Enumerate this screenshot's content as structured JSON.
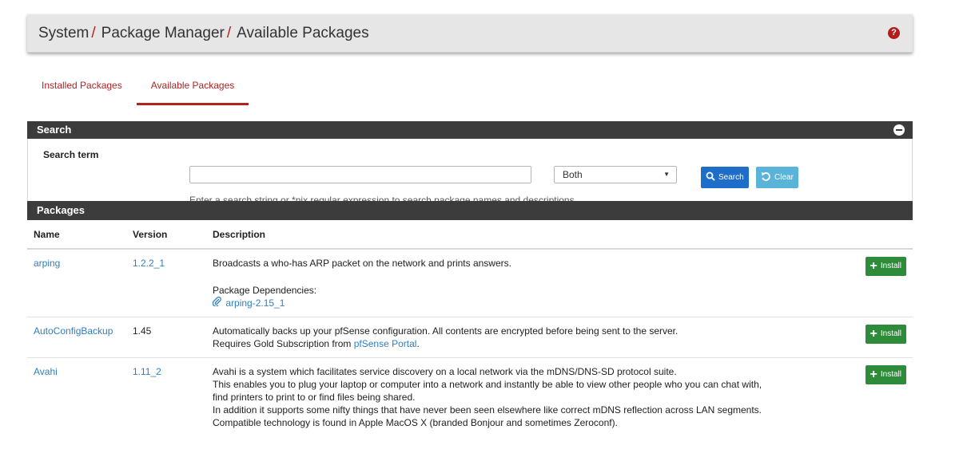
{
  "header": {
    "crumbs": [
      {
        "label": "System",
        "sep": "/"
      },
      {
        "label": "Package Manager",
        "sep": "/"
      },
      {
        "label": "Available Packages",
        "sep": ""
      }
    ],
    "help_icon": "?"
  },
  "tabs": [
    {
      "label": "Installed Packages",
      "active": false
    },
    {
      "label": "Available Packages",
      "active": true
    }
  ],
  "search": {
    "title": "Search",
    "term_label": "Search term",
    "input_value": "",
    "scope_selected": "Both",
    "search_button": "Search",
    "clear_button": "Clear",
    "help_text": "Enter a search string or *nix regular expression to search package names and descriptions."
  },
  "packages": {
    "title": "Packages",
    "columns": {
      "name": "Name",
      "version": "Version",
      "description": "Description"
    },
    "install_label": "Install",
    "rows": [
      {
        "name": "arping",
        "version": "1.2.2_1",
        "description": "Broadcasts a who-has ARP packet on the network and prints answers.",
        "deps_label": "Package Dependencies:",
        "dep": "arping-2.15_1"
      },
      {
        "name": "AutoConfigBackup",
        "version": "1.45",
        "description": "Automatically backs up your pfSense configuration. All contents are encrypted before being sent to the server.",
        "extra_prefix": "Requires Gold Subscription from ",
        "extra_link": "pfSense Portal",
        "extra_suffix": "."
      },
      {
        "name": "Avahi",
        "version": "1.11_2",
        "lines": [
          "Avahi is a system which facilitates service discovery on a local network via the mDNS/DNS-SD protocol suite.",
          "This enables you to plug your laptop or computer into a network and instantly be able to view other people who you can chat with,",
          "find printers to print to or find files being shared.",
          "In addition it supports some nifty things that have never been seen elsewhere like correct mDNS reflection across LAN segments.",
          "Compatible technology is found in Apple MacOS X (branded Bonjour and sometimes Zeroconf)."
        ]
      }
    ]
  },
  "icons": {
    "help": "question-circle-icon",
    "collapse": "minus-circle-icon",
    "search": "magnifier-icon",
    "clear": "undo-icon",
    "install": "plus-icon",
    "dependency": "paperclip-icon"
  },
  "colors": {
    "accent": "#b22222",
    "panel_head": "#3c3c3c",
    "link": "#2f7fc1",
    "search_btn": "#1e6ec9",
    "clear_btn": "#5ab3d9",
    "install_btn": "#2e8b3a"
  }
}
